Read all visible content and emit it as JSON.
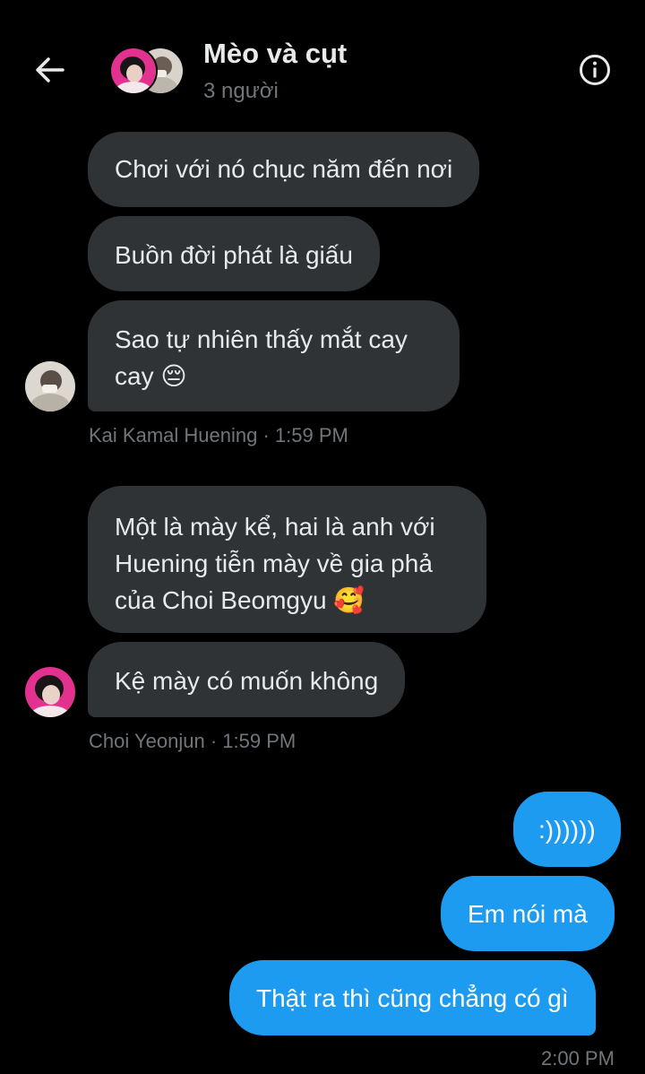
{
  "header": {
    "title": "Mèo và cụt",
    "subtitle": "3 người",
    "back_icon": "arrow-left-icon",
    "info_icon": "info-icon"
  },
  "colors": {
    "background": "#000000",
    "received_bubble": "#2f3336",
    "sent_bubble": "#1d9bf0",
    "meta_text": "#71767b"
  },
  "messages": [
    {
      "sender": "Kai Kamal Huening",
      "direction": "received",
      "lines": [
        "Chơi với nó chục năm đến nơi"
      ]
    },
    {
      "sender": "Kai Kamal Huening",
      "direction": "received",
      "lines": [
        "Buồn đời phát là giấu"
      ]
    },
    {
      "sender": "Kai Kamal Huening",
      "direction": "received",
      "lines": [
        "Sao tự nhiên thấy mắt cay",
        "cay 😔"
      ]
    },
    {
      "sender": "Choi Yeonjun",
      "direction": "received",
      "lines": [
        "Một là mày kể, hai là anh với",
        "Huening tiễn mày về gia phả",
        "của Choi Beomgyu 🥰"
      ]
    },
    {
      "sender": "Choi Yeonjun",
      "direction": "received",
      "lines": [
        "Kệ mày có muốn không"
      ]
    },
    {
      "sender": "me",
      "direction": "sent",
      "lines": [
        ":))))))"
      ]
    },
    {
      "sender": "me",
      "direction": "sent",
      "lines": [
        "Em nói mà"
      ]
    },
    {
      "sender": "me",
      "direction": "sent",
      "lines": [
        "Thật ra thì cũng chẳng có gì"
      ]
    }
  ],
  "groups": [
    {
      "sender_name": "Kai Kamal Huening",
      "separator": "·",
      "time": "1:59 PM"
    },
    {
      "sender_name": "Choi Yeonjun",
      "separator": "·",
      "time": "1:59 PM"
    },
    {
      "time": "2:00 PM"
    }
  ]
}
